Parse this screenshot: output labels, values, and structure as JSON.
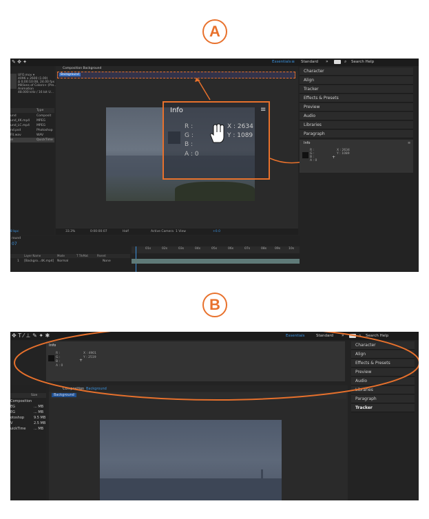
{
  "labels": {
    "a": "A",
    "b": "B"
  },
  "colors": {
    "accent": "#e8712c",
    "blue": "#3b93e0",
    "panel": "#232323"
  },
  "top": {
    "header": {
      "essentials": "Essentials",
      "menu_glyph": "≡",
      "standard": "Standard",
      "more": "»",
      "search": "Search Help"
    },
    "comp_tab": "Composition Background",
    "comp_chip": "Background",
    "project_info": [
      "UFO.mov ▾",
      "4096 x 2600 (1.00)",
      "Δ 0;00:10:08, 24.00 fps",
      "Millions of Colors+ (Pre...",
      "Animation",
      "48.000 kHz / 16 bit U..."
    ],
    "project_cols": {
      "name": "Name",
      "type": "Type"
    },
    "project_files": [
      {
        "name": "und",
        "type": "Composit"
      },
      {
        "name": "und_4K.mp4",
        "type": "MPEG"
      },
      {
        "name": "und_LC.mp4",
        "type": "MPEG"
      },
      {
        "name": "nd.psd",
        "type": "Photoshop"
      },
      {
        "name": "Fit.wav",
        "type": "WAV"
      },
      {
        "name": "ie",
        "type": "QuickTime"
      }
    ],
    "side_panels": [
      "Character",
      "Align",
      "Tracker",
      "Effects & Presets",
      "Preview",
      "Audio",
      "Libraries",
      "Paragraph"
    ],
    "info_panel": {
      "title": "Info",
      "menu": "≡",
      "rgba": [
        "R :",
        "G :",
        "B :",
        "A : 0"
      ],
      "x": "X : 2634",
      "y": "Y : 1089"
    },
    "callout": {
      "title": "Info",
      "menu": "≡",
      "r": "R :",
      "g": "G :",
      "b": "B :",
      "a": "A : 0",
      "x": "X : 2634",
      "y": "Y : 1089"
    },
    "viewer_bar": {
      "zoom": "33.3%",
      "time": "0:00:00:07",
      "res": "Half",
      "camera": "Active Camera",
      "views": "1 View",
      "exposure": "+0.0"
    },
    "timeline": {
      "tab": "round",
      "bits": "8 bpc",
      "time": "07",
      "ruler": [
        "01s",
        "02s",
        "03s",
        "04s",
        "05s",
        "06s",
        "07s",
        "08s",
        "09s",
        "10s"
      ],
      "cols": {
        "layer": "Layer Name",
        "mode": "Mode",
        "trk": "T TrkMat",
        "parent": "Parent"
      },
      "layer": {
        "num": "1",
        "name": "[Backgro...4K.mp4]",
        "mode": "Normal",
        "parent": "None"
      }
    }
  },
  "bottom": {
    "toolbar": {
      "essentials": "Essentials",
      "standard": "Standard",
      "more": "»",
      "search": "Search Help"
    },
    "info_panel": {
      "title": "Info",
      "rgba": [
        "R :",
        "G :",
        "B :",
        "A : 0"
      ],
      "x": "X : 4901",
      "y": "Y : 2519"
    },
    "comp_tab": "Composition",
    "comp_name": "Background",
    "comp_chip": "Background",
    "project_cols": {
      "size": "Size"
    },
    "project_files": [
      {
        "name": "Composition",
        "size": ""
      },
      {
        "name": "EG",
        "size": "... MB"
      },
      {
        "name": "EG",
        "size": "... MB"
      },
      {
        "name": "otoshop",
        "size": "9.5 MB"
      },
      {
        "name": "V",
        "size": "2.5 MB"
      },
      {
        "name": "uickTime",
        "size": "... MB"
      }
    ],
    "side_panels": [
      "Character",
      "Align",
      "Effects & Presets",
      "Preview",
      "Audio",
      "Libraries",
      "Paragraph",
      "Tracker"
    ]
  }
}
